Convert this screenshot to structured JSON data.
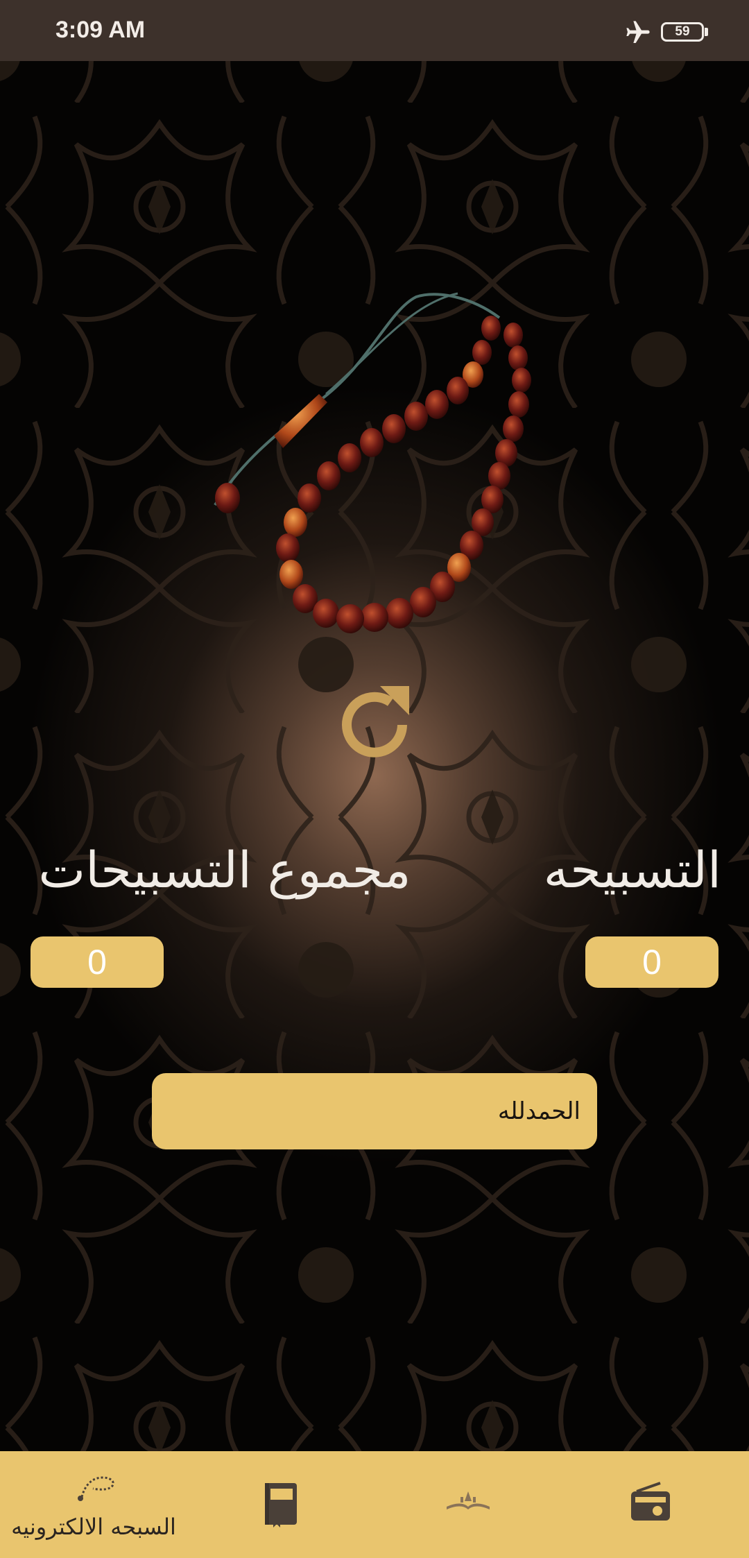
{
  "status_bar": {
    "time": "3:09 AM",
    "battery": "59"
  },
  "counters": {
    "total_label": "مجموع التسبيحات",
    "count_label": "التسبيحه",
    "total_value": "0",
    "count_value": "0"
  },
  "dhikr": {
    "label": "الحمدلله"
  },
  "bottom_nav": {
    "items": [
      {
        "label": "السبحه الالكترونيه",
        "icon": "tasbih-icon"
      },
      {
        "label": "",
        "icon": "book-icon"
      },
      {
        "label": "",
        "icon": "quran-icon"
      },
      {
        "label": "",
        "icon": "radio-icon"
      }
    ]
  },
  "colors": {
    "accent": "#e9c56e",
    "status_bar": "#3d312b",
    "background": "#050403",
    "reset_icon": "#c9a05a"
  }
}
